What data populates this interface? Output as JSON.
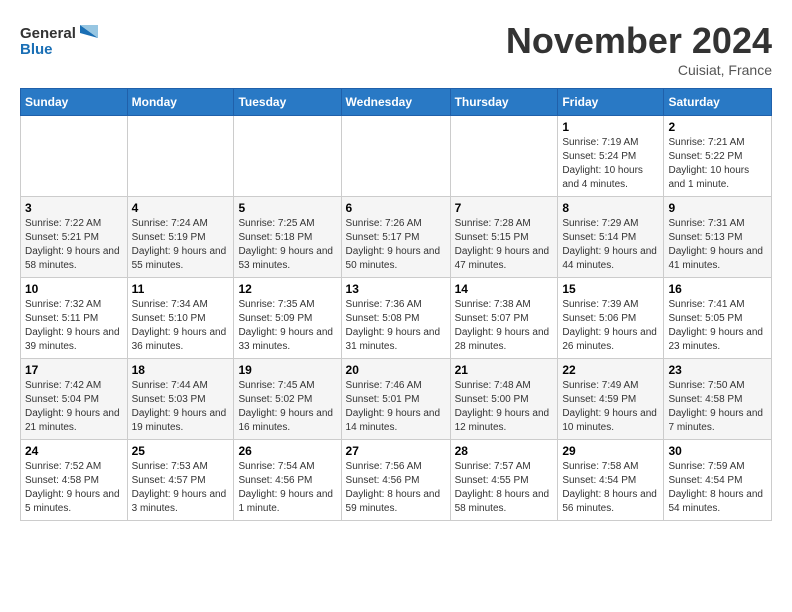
{
  "header": {
    "logo_line1": "General",
    "logo_line2": "Blue",
    "month": "November 2024",
    "location": "Cuisiat, France"
  },
  "days_of_week": [
    "Sunday",
    "Monday",
    "Tuesday",
    "Wednesday",
    "Thursday",
    "Friday",
    "Saturday"
  ],
  "weeks": [
    [
      {
        "day": "",
        "info": ""
      },
      {
        "day": "",
        "info": ""
      },
      {
        "day": "",
        "info": ""
      },
      {
        "day": "",
        "info": ""
      },
      {
        "day": "",
        "info": ""
      },
      {
        "day": "1",
        "info": "Sunrise: 7:19 AM\nSunset: 5:24 PM\nDaylight: 10 hours\nand 4 minutes."
      },
      {
        "day": "2",
        "info": "Sunrise: 7:21 AM\nSunset: 5:22 PM\nDaylight: 10 hours\nand 1 minute."
      }
    ],
    [
      {
        "day": "3",
        "info": "Sunrise: 7:22 AM\nSunset: 5:21 PM\nDaylight: 9 hours\nand 58 minutes."
      },
      {
        "day": "4",
        "info": "Sunrise: 7:24 AM\nSunset: 5:19 PM\nDaylight: 9 hours\nand 55 minutes."
      },
      {
        "day": "5",
        "info": "Sunrise: 7:25 AM\nSunset: 5:18 PM\nDaylight: 9 hours\nand 53 minutes."
      },
      {
        "day": "6",
        "info": "Sunrise: 7:26 AM\nSunset: 5:17 PM\nDaylight: 9 hours\nand 50 minutes."
      },
      {
        "day": "7",
        "info": "Sunrise: 7:28 AM\nSunset: 5:15 PM\nDaylight: 9 hours\nand 47 minutes."
      },
      {
        "day": "8",
        "info": "Sunrise: 7:29 AM\nSunset: 5:14 PM\nDaylight: 9 hours\nand 44 minutes."
      },
      {
        "day": "9",
        "info": "Sunrise: 7:31 AM\nSunset: 5:13 PM\nDaylight: 9 hours\nand 41 minutes."
      }
    ],
    [
      {
        "day": "10",
        "info": "Sunrise: 7:32 AM\nSunset: 5:11 PM\nDaylight: 9 hours\nand 39 minutes."
      },
      {
        "day": "11",
        "info": "Sunrise: 7:34 AM\nSunset: 5:10 PM\nDaylight: 9 hours\nand 36 minutes."
      },
      {
        "day": "12",
        "info": "Sunrise: 7:35 AM\nSunset: 5:09 PM\nDaylight: 9 hours\nand 33 minutes."
      },
      {
        "day": "13",
        "info": "Sunrise: 7:36 AM\nSunset: 5:08 PM\nDaylight: 9 hours\nand 31 minutes."
      },
      {
        "day": "14",
        "info": "Sunrise: 7:38 AM\nSunset: 5:07 PM\nDaylight: 9 hours\nand 28 minutes."
      },
      {
        "day": "15",
        "info": "Sunrise: 7:39 AM\nSunset: 5:06 PM\nDaylight: 9 hours\nand 26 minutes."
      },
      {
        "day": "16",
        "info": "Sunrise: 7:41 AM\nSunset: 5:05 PM\nDaylight: 9 hours\nand 23 minutes."
      }
    ],
    [
      {
        "day": "17",
        "info": "Sunrise: 7:42 AM\nSunset: 5:04 PM\nDaylight: 9 hours\nand 21 minutes."
      },
      {
        "day": "18",
        "info": "Sunrise: 7:44 AM\nSunset: 5:03 PM\nDaylight: 9 hours\nand 19 minutes."
      },
      {
        "day": "19",
        "info": "Sunrise: 7:45 AM\nSunset: 5:02 PM\nDaylight: 9 hours\nand 16 minutes."
      },
      {
        "day": "20",
        "info": "Sunrise: 7:46 AM\nSunset: 5:01 PM\nDaylight: 9 hours\nand 14 minutes."
      },
      {
        "day": "21",
        "info": "Sunrise: 7:48 AM\nSunset: 5:00 PM\nDaylight: 9 hours\nand 12 minutes."
      },
      {
        "day": "22",
        "info": "Sunrise: 7:49 AM\nSunset: 4:59 PM\nDaylight: 9 hours\nand 10 minutes."
      },
      {
        "day": "23",
        "info": "Sunrise: 7:50 AM\nSunset: 4:58 PM\nDaylight: 9 hours\nand 7 minutes."
      }
    ],
    [
      {
        "day": "24",
        "info": "Sunrise: 7:52 AM\nSunset: 4:58 PM\nDaylight: 9 hours\nand 5 minutes."
      },
      {
        "day": "25",
        "info": "Sunrise: 7:53 AM\nSunset: 4:57 PM\nDaylight: 9 hours\nand 3 minutes."
      },
      {
        "day": "26",
        "info": "Sunrise: 7:54 AM\nSunset: 4:56 PM\nDaylight: 9 hours\nand 1 minute."
      },
      {
        "day": "27",
        "info": "Sunrise: 7:56 AM\nSunset: 4:56 PM\nDaylight: 8 hours\nand 59 minutes."
      },
      {
        "day": "28",
        "info": "Sunrise: 7:57 AM\nSunset: 4:55 PM\nDaylight: 8 hours\nand 58 minutes."
      },
      {
        "day": "29",
        "info": "Sunrise: 7:58 AM\nSunset: 4:54 PM\nDaylight: 8 hours\nand 56 minutes."
      },
      {
        "day": "30",
        "info": "Sunrise: 7:59 AM\nSunset: 4:54 PM\nDaylight: 8 hours\nand 54 minutes."
      }
    ]
  ]
}
